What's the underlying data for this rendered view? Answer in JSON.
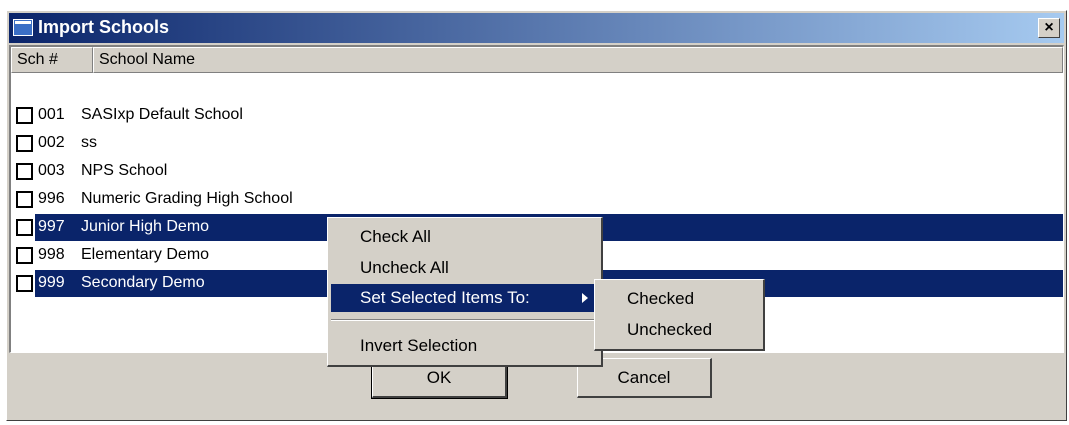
{
  "window": {
    "title": "Import Schools",
    "close_label": "×"
  },
  "list": {
    "columns": [
      {
        "label": "Sch #"
      },
      {
        "label": "School Name"
      }
    ],
    "rows": [
      {
        "num": "001",
        "name": "SASIxp Default School",
        "checked": false,
        "selected": false
      },
      {
        "num": "002",
        "name": "ss",
        "checked": false,
        "selected": false
      },
      {
        "num": "003",
        "name": "NPS School",
        "checked": false,
        "selected": false
      },
      {
        "num": "996",
        "name": "Numeric Grading High School",
        "checked": false,
        "selected": false
      },
      {
        "num": "997",
        "name": "Junior High Demo",
        "checked": false,
        "selected": true
      },
      {
        "num": "998",
        "name": "Elementary Demo",
        "checked": false,
        "selected": false
      },
      {
        "num": "999",
        "name": "Secondary Demo",
        "checked": false,
        "selected": true
      }
    ]
  },
  "buttons": {
    "ok": "OK",
    "cancel": "Cancel"
  },
  "context_menu": {
    "check_all": "Check All",
    "uncheck_all": "Uncheck All",
    "set_selected": "Set Selected Items To:",
    "invert": "Invert Selection"
  },
  "submenu": {
    "checked": "Checked",
    "unchecked": "Unchecked"
  },
  "colors": {
    "selection": "#0a246a",
    "face": "#d4d0c8"
  }
}
